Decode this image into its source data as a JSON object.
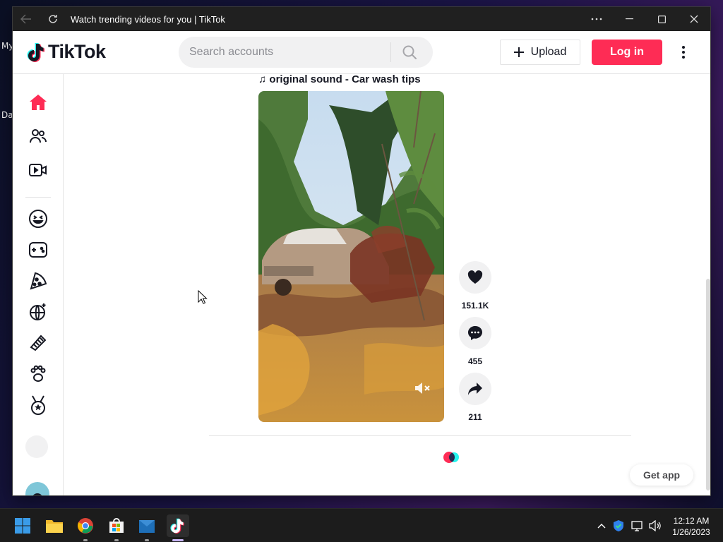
{
  "desktop": {
    "label_top": "My",
    "label_bottom": "Da"
  },
  "window": {
    "title": "Watch trending videos for you | TikTok"
  },
  "header": {
    "logo_text": "TikTok",
    "search_placeholder": "Search accounts",
    "upload_label": "Upload",
    "login_label": "Log in"
  },
  "sidebar": {
    "items": [
      {
        "icon": "home-icon",
        "active": true
      },
      {
        "icon": "following-icon"
      },
      {
        "icon": "live-icon"
      },
      {
        "icon": "comedy-icon"
      },
      {
        "icon": "gaming-icon"
      },
      {
        "icon": "food-icon"
      },
      {
        "icon": "dance-icon"
      },
      {
        "icon": "beauty-icon"
      },
      {
        "icon": "animals-icon"
      },
      {
        "icon": "sports-icon"
      }
    ]
  },
  "post": {
    "sound": "original sound - Car wash tips",
    "likes": "151.1K",
    "comments": "455",
    "shares": "211"
  },
  "get_app_label": "Get app",
  "taskbar": {
    "time": "12:12 AM",
    "date": "1/26/2023"
  },
  "colors": {
    "brand": "#fe2c55",
    "brand_cyan": "#25f4ee",
    "text": "#161823"
  }
}
